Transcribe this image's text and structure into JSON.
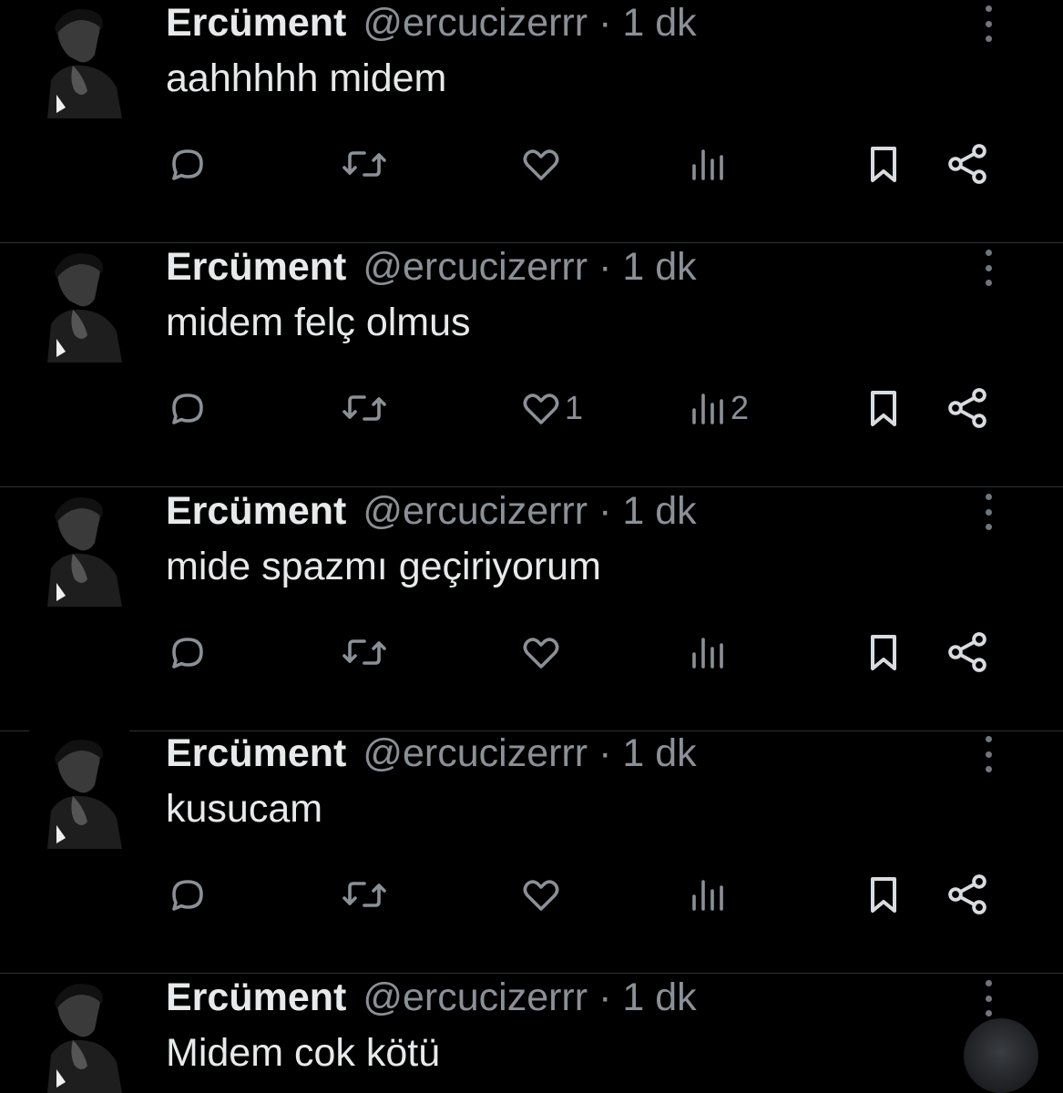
{
  "tweets": [
    {
      "author_name": "Ercüment",
      "handle": "@ercucizerrr",
      "separator": "·",
      "time": "1 dk",
      "text": "aahhhhh midem",
      "like_count": "",
      "view_count": ""
    },
    {
      "author_name": "Ercüment",
      "handle": "@ercucizerrr",
      "separator": "·",
      "time": "1 dk",
      "text": "midem felç olmus",
      "like_count": "1",
      "view_count": "2"
    },
    {
      "author_name": "Ercüment",
      "handle": "@ercucizerrr",
      "separator": "·",
      "time": "1 dk",
      "text": "mide spazmı geçiriyorum",
      "like_count": "",
      "view_count": ""
    },
    {
      "author_name": "Ercüment",
      "handle": "@ercucizerrr",
      "separator": "·",
      "time": "1 dk",
      "text": "kusucam",
      "like_count": "",
      "view_count": ""
    },
    {
      "author_name": "Ercüment",
      "handle": "@ercucizerrr",
      "separator": "·",
      "time": "1 dk",
      "text": "Midem cok kötü",
      "like_count": "",
      "view_count": ""
    }
  ],
  "icons": {
    "reply": "reply-icon",
    "retweet": "retweet-icon",
    "like": "heart-icon",
    "views": "views-icon",
    "bookmark": "bookmark-icon",
    "share": "share-icon",
    "more": "more-icon"
  },
  "colors": {
    "background": "#000000",
    "text": "#e7e9ea",
    "secondary": "#8b9096",
    "divider": "#2f3336"
  }
}
